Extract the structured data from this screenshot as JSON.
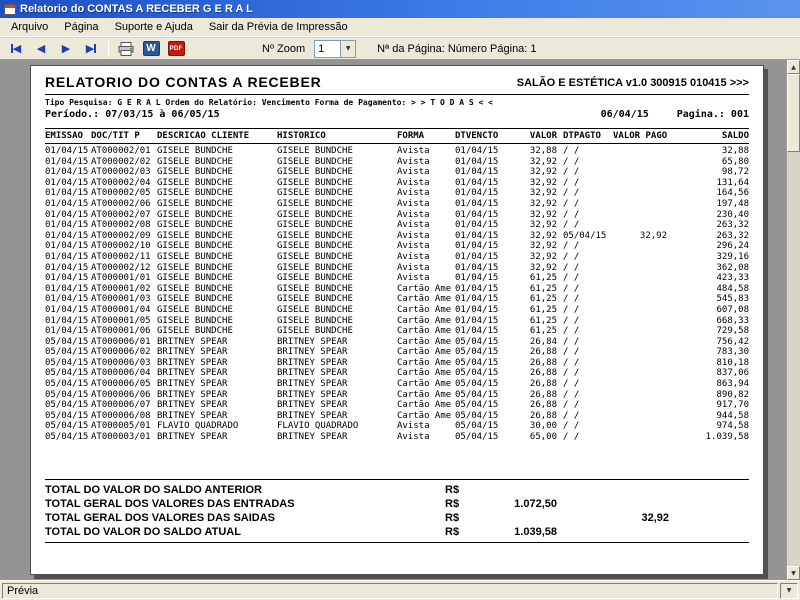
{
  "window": {
    "title": "Relatorio do CONTAS A RECEBER G E R A L"
  },
  "menu": {
    "items": [
      "Arquivo",
      "Página",
      "Suporte e Ajuda",
      "Sair da Prévia de Impressão"
    ]
  },
  "toolbar": {
    "word_label": "W",
    "pdf_label": "PDF",
    "zoom_label": "Nº Zoom",
    "zoom_value": "1",
    "page_info": "Nª da Página: Número Página: 1"
  },
  "icons": {
    "first_page": "◀",
    "prev_page": "◀",
    "next_page": "▶",
    "last_page": "▶",
    "dropdown": "▼",
    "scroll_up": "▲",
    "scroll_down": "▼",
    "status_dropdown": "▼"
  },
  "report": {
    "title": "RELATORIO DO CONTAS A RECEBER",
    "app_version": "SALÃO E ESTÉTICA v1.0 300915 010415 >>>",
    "filters": "Tipo Pesquisa: G E R A L   Ordem do Relatório: Vencimento   Forma de Pagamento: > > T O D A S < <",
    "period": "Período.: 07/03/15 à 06/05/15",
    "print_date": "06/04/15",
    "page_number": "Pagina.: 001",
    "columns": [
      "EMISSAO",
      "DOC/TIT P",
      "DESCRICAO CLIENTE",
      "HISTORICO",
      "FORMA",
      "DTVENCTO",
      "VALOR",
      "DTPAGTO",
      "VALOR PAGO",
      "SALDO"
    ],
    "rows": [
      [
        "01/04/15",
        "AT000002/01",
        "GISELE BUNDCHE",
        "GISELE BUNDCHE",
        "Avista",
        "01/04/15",
        "32,88",
        "/ /",
        "",
        "32,88"
      ],
      [
        "01/04/15",
        "AT000002/02",
        "GISELE BUNDCHE",
        "GISELE BUNDCHE",
        "Avista",
        "01/04/15",
        "32,92",
        "/ /",
        "",
        "65,80"
      ],
      [
        "01/04/15",
        "AT000002/03",
        "GISELE BUNDCHE",
        "GISELE BUNDCHE",
        "Avista",
        "01/04/15",
        "32,92",
        "/ /",
        "",
        "98,72"
      ],
      [
        "01/04/15",
        "AT000002/04",
        "GISELE BUNDCHE",
        "GISELE BUNDCHE",
        "Avista",
        "01/04/15",
        "32,92",
        "/ /",
        "",
        "131,64"
      ],
      [
        "01/04/15",
        "AT000002/05",
        "GISELE BUNDCHE",
        "GISELE BUNDCHE",
        "Avista",
        "01/04/15",
        "32,92",
        "/ /",
        "",
        "164,56"
      ],
      [
        "01/04/15",
        "AT000002/06",
        "GISELE BUNDCHE",
        "GISELE BUNDCHE",
        "Avista",
        "01/04/15",
        "32,92",
        "/ /",
        "",
        "197,48"
      ],
      [
        "01/04/15",
        "AT000002/07",
        "GISELE BUNDCHE",
        "GISELE BUNDCHE",
        "Avista",
        "01/04/15",
        "32,92",
        "/ /",
        "",
        "230,40"
      ],
      [
        "01/04/15",
        "AT000002/08",
        "GISELE BUNDCHE",
        "GISELE BUNDCHE",
        "Avista",
        "01/04/15",
        "32,92",
        "/ /",
        "",
        "263,32"
      ],
      [
        "01/04/15",
        "AT000002/09",
        "GISELE BUNDCHE",
        "GISELE BUNDCHE",
        "Avista",
        "01/04/15",
        "32,92",
        "05/04/15",
        "32,92",
        "263,32"
      ],
      [
        "01/04/15",
        "AT000002/10",
        "GISELE BUNDCHE",
        "GISELE BUNDCHE",
        "Avista",
        "01/04/15",
        "32,92",
        "/ /",
        "",
        "296,24"
      ],
      [
        "01/04/15",
        "AT000002/11",
        "GISELE BUNDCHE",
        "GISELE BUNDCHE",
        "Avista",
        "01/04/15",
        "32,92",
        "/ /",
        "",
        "329,16"
      ],
      [
        "01/04/15",
        "AT000002/12",
        "GISELE BUNDCHE",
        "GISELE BUNDCHE",
        "Avista",
        "01/04/15",
        "32,92",
        "/ /",
        "",
        "362,08"
      ],
      [
        "01/04/15",
        "AT000001/01",
        "GISELE BUNDCHE",
        "GISELE BUNDCHE",
        "Avista",
        "01/04/15",
        "61,25",
        "/ /",
        "",
        "423,33"
      ],
      [
        "01/04/15",
        "AT000001/02",
        "GISELE BUNDCHE",
        "GISELE BUNDCHE",
        "Cartão Ame",
        "01/04/15",
        "61,25",
        "/ /",
        "",
        "484,58"
      ],
      [
        "01/04/15",
        "AT000001/03",
        "GISELE BUNDCHE",
        "GISELE BUNDCHE",
        "Cartão Ame",
        "01/04/15",
        "61,25",
        "/ /",
        "",
        "545,83"
      ],
      [
        "01/04/15",
        "AT000001/04",
        "GISELE BUNDCHE",
        "GISELE BUNDCHE",
        "Cartão Ame",
        "01/04/15",
        "61,25",
        "/ /",
        "",
        "607,08"
      ],
      [
        "01/04/15",
        "AT000001/05",
        "GISELE BUNDCHE",
        "GISELE BUNDCHE",
        "Cartão Ame",
        "01/04/15",
        "61,25",
        "/ /",
        "",
        "668,33"
      ],
      [
        "01/04/15",
        "AT000001/06",
        "GISELE BUNDCHE",
        "GISELE BUNDCHE",
        "Cartão Ame",
        "01/04/15",
        "61,25",
        "/ /",
        "",
        "729,58"
      ],
      [
        "05/04/15",
        "AT000006/01",
        "BRITNEY SPEAR",
        "BRITNEY SPEAR",
        "Cartão Ame",
        "05/04/15",
        "26,84",
        "/ /",
        "",
        "756,42"
      ],
      [
        "05/04/15",
        "AT000006/02",
        "BRITNEY SPEAR",
        "BRITNEY SPEAR",
        "Cartão Ame",
        "05/04/15",
        "26,88",
        "/ /",
        "",
        "783,30"
      ],
      [
        "05/04/15",
        "AT000006/03",
        "BRITNEY SPEAR",
        "BRITNEY SPEAR",
        "Cartão Ame",
        "05/04/15",
        "26,88",
        "/ /",
        "",
        "810,18"
      ],
      [
        "05/04/15",
        "AT000006/04",
        "BRITNEY SPEAR",
        "BRITNEY SPEAR",
        "Cartão Ame",
        "05/04/15",
        "26,88",
        "/ /",
        "",
        "837,06"
      ],
      [
        "05/04/15",
        "AT000006/05",
        "BRITNEY SPEAR",
        "BRITNEY SPEAR",
        "Cartão Ame",
        "05/04/15",
        "26,88",
        "/ /",
        "",
        "863,94"
      ],
      [
        "05/04/15",
        "AT000006/06",
        "BRITNEY SPEAR",
        "BRITNEY SPEAR",
        "Cartão Ame",
        "05/04/15",
        "26,88",
        "/ /",
        "",
        "890,82"
      ],
      [
        "05/04/15",
        "AT000006/07",
        "BRITNEY SPEAR",
        "BRITNEY SPEAR",
        "Cartão Ame",
        "05/04/15",
        "26,88",
        "/ /",
        "",
        "917,70"
      ],
      [
        "05/04/15",
        "AT000006/08",
        "BRITNEY SPEAR",
        "BRITNEY SPEAR",
        "Cartão Ame",
        "05/04/15",
        "26,88",
        "/ /",
        "",
        "944,58"
      ],
      [
        "05/04/15",
        "AT000005/01",
        "FLÁVIO QUADRADO",
        "FLÁVIO QUADRADO",
        "Avista",
        "05/04/15",
        "30,00",
        "/ /",
        "",
        "974,58"
      ],
      [
        "05/04/15",
        "AT000003/01",
        "BRITNEY SPEAR",
        "BRITNEY SPEAR",
        "Avista",
        "05/04/15",
        "65,00",
        "/ /",
        "",
        "1.039,58"
      ]
    ],
    "totals": [
      {
        "label": "TOTAL DO VALOR DO SALDO ANTERIOR",
        "currency": "R$",
        "value": "",
        "value2": ""
      },
      {
        "label": "TOTAL GERAL DOS VALORES DAS ENTRADAS",
        "currency": "R$",
        "value": "1.072,50",
        "value2": ""
      },
      {
        "label": "TOTAL GERAL DOS VALORES DAS SAIDAS",
        "currency": "R$",
        "value": "",
        "value2": "32,92"
      },
      {
        "label": "TOTAL DO VALOR DO SALDO ATUAL",
        "currency": "R$",
        "value": "1.039,58",
        "value2": ""
      }
    ]
  },
  "statusbar": {
    "left": "Prévia"
  }
}
